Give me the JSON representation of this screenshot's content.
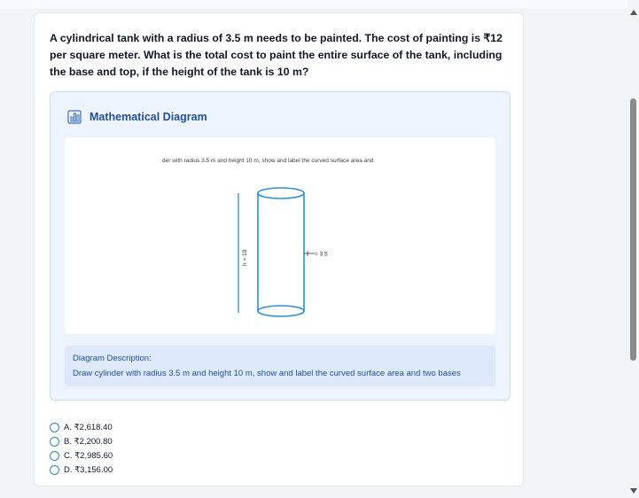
{
  "question": {
    "text": "A cylindrical tank with a radius of 3.5 m needs to be painted. The cost of painting is ₹12 per square meter. What is the total cost to paint the entire surface of the tank, including the base and top, if the height of the tank is 10 m?"
  },
  "diagram": {
    "title": "Mathematical Diagram",
    "icon": "bar-chart-icon",
    "caption": "der with radius 3.5 m and height 10 m, show and label the curved surface area and",
    "height_label": "h = 10",
    "radius_label": "= 3.5",
    "description_label": "Diagram Description:",
    "description_text": "Draw cylinder with radius 3.5 m and height 10 m, show and label the curved surface area and two bases"
  },
  "options": [
    {
      "label": "A. ₹2,618.40"
    },
    {
      "label": "B. ₹2,200.80"
    },
    {
      "label": "C. ₹2,985.60"
    },
    {
      "label": "D. ₹3,156.00"
    }
  ],
  "colors": {
    "accent": "#1f4f9a",
    "cylinder_stroke": "#2b8fd6",
    "cylinder_fill": "#ffffff"
  }
}
